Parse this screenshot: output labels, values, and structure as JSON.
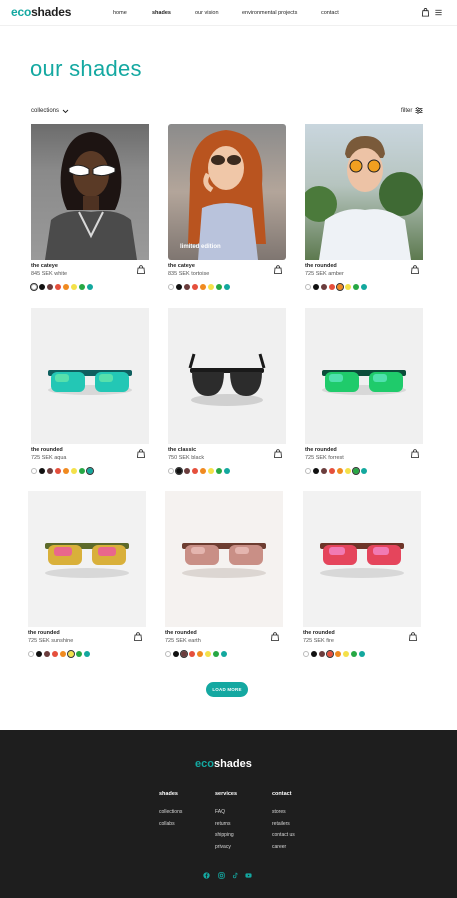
{
  "brand": {
    "part1": "eco",
    "part2": "shades"
  },
  "nav": {
    "items": [
      "home",
      "shades",
      "our vision",
      "environmental projects",
      "contact"
    ],
    "active": "shades"
  },
  "page": {
    "title": "our shades",
    "collections_label": "collections",
    "filter_label": "filter"
  },
  "products": [
    {
      "name": "the cateye",
      "price": "845 SEK white",
      "badge": "",
      "colors": [
        "#ffffff",
        "#111111",
        "#6b3d3d",
        "#e54f3c",
        "#f08a20",
        "#f4e14a",
        "#27a844",
        "#13a89e"
      ],
      "selected": 0
    },
    {
      "name": "the cateye",
      "price": "835 SEK tortoise",
      "badge": "limited edition",
      "colors": [
        "#ffffff",
        "#111111",
        "#6b3d3d",
        "#e54f3c",
        "#f08a20",
        "#f4e14a",
        "#27a844",
        "#13a89e"
      ],
      "selected": -1
    },
    {
      "name": "the rounded",
      "price": "725 SEK amber",
      "badge": "",
      "colors": [
        "#ffffff",
        "#111111",
        "#6b3d3d",
        "#e54f3c",
        "#f08a20",
        "#f4e14a",
        "#27a844",
        "#13a89e"
      ],
      "selected": 4
    },
    {
      "name": "the rounded",
      "price": "725 SEK aqua",
      "badge": "",
      "colors": [
        "#ffffff",
        "#111111",
        "#6b3d3d",
        "#e54f3c",
        "#f08a20",
        "#f4e14a",
        "#27a844",
        "#13a89e"
      ],
      "selected": 7
    },
    {
      "name": "the classic",
      "price": "750 SEK black",
      "badge": "",
      "colors": [
        "#ffffff",
        "#111111",
        "#6b3d3d",
        "#e54f3c",
        "#f08a20",
        "#f4e14a",
        "#27a844",
        "#13a89e"
      ],
      "selected": 1
    },
    {
      "name": "the rounded",
      "price": "725 SEK forrest",
      "badge": "",
      "colors": [
        "#ffffff",
        "#111111",
        "#6b3d3d",
        "#e54f3c",
        "#f08a20",
        "#f4e14a",
        "#27a844",
        "#13a89e"
      ],
      "selected": 6
    },
    {
      "name": "the rounded",
      "price": "725 SEK sunshine",
      "badge": "",
      "colors": [
        "#ffffff",
        "#111111",
        "#6b3d3d",
        "#e54f3c",
        "#f08a20",
        "#f4e14a",
        "#27a844",
        "#13a89e"
      ],
      "selected": 5
    },
    {
      "name": "the rounded",
      "price": "725 SEK earth",
      "badge": "",
      "colors": [
        "#ffffff",
        "#111111",
        "#6b3d3d",
        "#e54f3c",
        "#f08a20",
        "#f4e14a",
        "#27a844",
        "#13a89e"
      ],
      "selected": 2
    },
    {
      "name": "the rounded",
      "price": "725 SEK fire",
      "badge": "",
      "colors": [
        "#ffffff",
        "#111111",
        "#6b3d3d",
        "#e54f3c",
        "#f08a20",
        "#f4e14a",
        "#27a844",
        "#13a89e"
      ],
      "selected": 3
    }
  ],
  "load_more": "LOAD MORE",
  "footer": {
    "columns": [
      {
        "title": "shades",
        "links": [
          "collections",
          "collabs"
        ]
      },
      {
        "title": "services",
        "links": [
          "FAQ",
          "returns",
          "shipping",
          "privacy"
        ]
      },
      {
        "title": "contact",
        "links": [
          "stores",
          "retailers",
          "contact us",
          "career"
        ]
      }
    ],
    "social_icons": [
      "facebook-icon",
      "instagram-icon",
      "tiktok-icon",
      "youtube-icon"
    ]
  },
  "colors": {
    "accent": "#14a8a1",
    "footer_bg": "#1e1e1e"
  }
}
